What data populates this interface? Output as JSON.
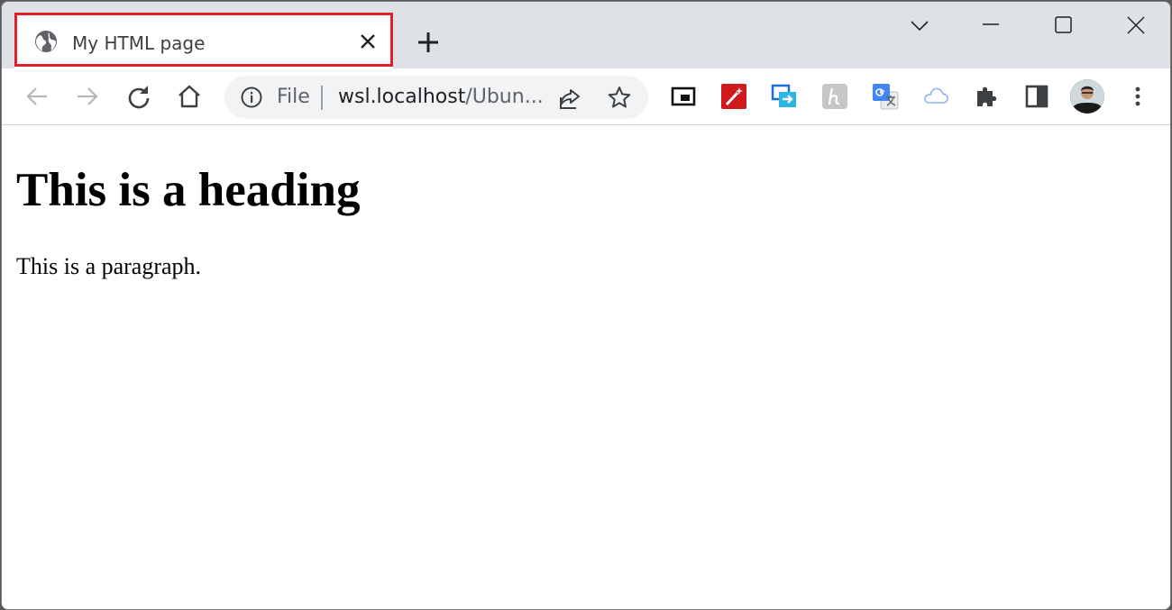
{
  "tab": {
    "title": "My HTML page",
    "favicon": "globe-icon",
    "highlight_color": "#e0202a"
  },
  "titlebar": {
    "new_tab_icon": "plus-icon",
    "controls": [
      "chevron-down-icon",
      "minimize-icon",
      "maximize-icon",
      "close-icon"
    ]
  },
  "toolbar": {
    "nav_icons": [
      "back-arrow-icon",
      "forward-arrow-icon",
      "reload-icon",
      "home-icon"
    ],
    "omnibox": {
      "scheme_label": "File",
      "url_host": "wsl.localhost",
      "url_rest": "/Ubun..."
    },
    "extensions": [
      "picture-in-picture-icon",
      "magic-wand-extension-icon",
      "screen-capture-extension-icon",
      "h-extension-icon",
      "google-translate-icon",
      "cloud-icon",
      "puzzle-extensions-icon",
      "side-panel-icon"
    ],
    "menu_icon": "kebab-menu-icon"
  },
  "page": {
    "heading": "This is a heading",
    "paragraph": "This is a paragraph."
  }
}
